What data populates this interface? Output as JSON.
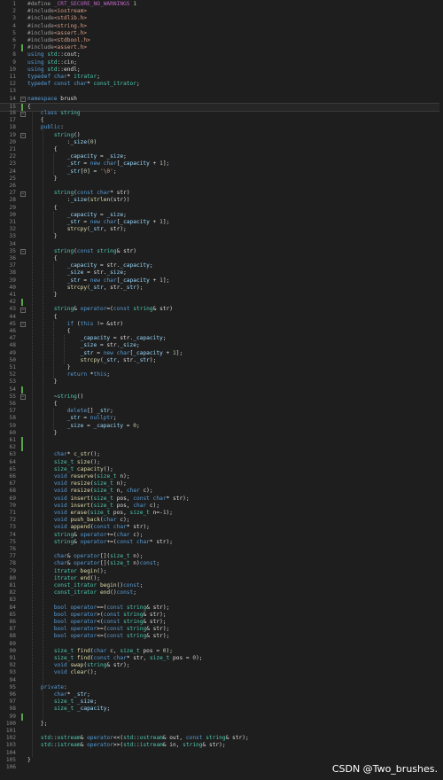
{
  "editor": {
    "current_line": 15,
    "lines": [
      {
        "n": "1",
        "t": "#define _CRT_SECURE_NO_WARNINGS 1",
        "c": "pp"
      },
      {
        "n": "2",
        "t": "#include<iostream>",
        "c": "pp"
      },
      {
        "n": "3",
        "t": "#include<stdlib.h>",
        "c": "pp"
      },
      {
        "n": "4",
        "t": "#include<string.h>",
        "c": "pp"
      },
      {
        "n": "5",
        "t": "#include<assert.h>",
        "c": "pp"
      },
      {
        "n": "6",
        "t": "#include<stdbool.h>",
        "c": "pp"
      },
      {
        "n": "7",
        "t": "#include<assert.h>",
        "c": "pp"
      },
      {
        "n": "8",
        "t": "using std::cout;",
        "c": ""
      },
      {
        "n": "9",
        "t": "using std::cin;",
        "c": ""
      },
      {
        "n": "10",
        "t": "using std::endl;",
        "c": ""
      },
      {
        "n": "11",
        "t": "typedef char* itrator;",
        "c": ""
      },
      {
        "n": "12",
        "t": "typedef const char* const_itrator;",
        "c": ""
      },
      {
        "n": "13",
        "t": "",
        "c": ""
      },
      {
        "n": "14",
        "t": "namespace brush",
        "c": ""
      },
      {
        "n": "15",
        "t": "{",
        "c": ""
      },
      {
        "n": "16",
        "t": "    class string",
        "c": ""
      },
      {
        "n": "17",
        "t": "    {",
        "c": ""
      },
      {
        "n": "18",
        "t": "    public:",
        "c": ""
      },
      {
        "n": "19",
        "t": "        string()",
        "c": ""
      },
      {
        "n": "20",
        "t": "            :_size(0)",
        "c": ""
      },
      {
        "n": "21",
        "t": "        {",
        "c": ""
      },
      {
        "n": "22",
        "t": "            _capacity = _size;",
        "c": ""
      },
      {
        "n": "23",
        "t": "            _str = new char[_capacity + 1];",
        "c": ""
      },
      {
        "n": "24",
        "t": "            _str[0] = '\\0';",
        "c": ""
      },
      {
        "n": "25",
        "t": "        }",
        "c": ""
      },
      {
        "n": "26",
        "t": "",
        "c": ""
      },
      {
        "n": "27",
        "t": "        string(const char* str)",
        "c": ""
      },
      {
        "n": "28",
        "t": "            :_size(strlen(str))",
        "c": ""
      },
      {
        "n": "29",
        "t": "        {",
        "c": ""
      },
      {
        "n": "30",
        "t": "            _capacity = _size;",
        "c": ""
      },
      {
        "n": "31",
        "t": "            _str = new char[_capacity + 1];",
        "c": ""
      },
      {
        "n": "32",
        "t": "            strcpy(_str, str);",
        "c": ""
      },
      {
        "n": "33",
        "t": "        }",
        "c": ""
      },
      {
        "n": "34",
        "t": "",
        "c": ""
      },
      {
        "n": "35",
        "t": "        string(const string& str)",
        "c": ""
      },
      {
        "n": "36",
        "t": "        {",
        "c": ""
      },
      {
        "n": "37",
        "t": "            _capacity = str._capacity;",
        "c": ""
      },
      {
        "n": "38",
        "t": "            _size = str._size;",
        "c": ""
      },
      {
        "n": "39",
        "t": "            _str = new char[_capacity + 1];",
        "c": ""
      },
      {
        "n": "40",
        "t": "            strcpy(_str, str._str);",
        "c": ""
      },
      {
        "n": "41",
        "t": "        }",
        "c": ""
      },
      {
        "n": "42",
        "t": "",
        "c": ""
      },
      {
        "n": "43",
        "t": "        string& operator=(const string& str)",
        "c": ""
      },
      {
        "n": "44",
        "t": "        {",
        "c": ""
      },
      {
        "n": "45",
        "t": "            if (this != &str)",
        "c": ""
      },
      {
        "n": "46",
        "t": "            {",
        "c": ""
      },
      {
        "n": "47",
        "t": "                _capacity = str._capacity;",
        "c": ""
      },
      {
        "n": "48",
        "t": "                _size = str._size;",
        "c": ""
      },
      {
        "n": "49",
        "t": "                _str = new char[_capacity + 1];",
        "c": ""
      },
      {
        "n": "50",
        "t": "                strcpy(_str, str._str);",
        "c": ""
      },
      {
        "n": "51",
        "t": "            }",
        "c": ""
      },
      {
        "n": "52",
        "t": "            return *this;",
        "c": ""
      },
      {
        "n": "53",
        "t": "        }",
        "c": ""
      },
      {
        "n": "54",
        "t": "",
        "c": ""
      },
      {
        "n": "55",
        "t": "        ~string()",
        "c": ""
      },
      {
        "n": "56",
        "t": "        {",
        "c": ""
      },
      {
        "n": "57",
        "t": "            delete[] _str;",
        "c": ""
      },
      {
        "n": "58",
        "t": "            _str = nullptr;",
        "c": ""
      },
      {
        "n": "59",
        "t": "            _size = _capacity = 0;",
        "c": ""
      },
      {
        "n": "60",
        "t": "        }",
        "c": ""
      },
      {
        "n": "61",
        "t": "",
        "c": ""
      },
      {
        "n": "62",
        "t": "",
        "c": ""
      },
      {
        "n": "63",
        "t": "        char* c_str();",
        "c": ""
      },
      {
        "n": "64",
        "t": "        size_t size();",
        "c": ""
      },
      {
        "n": "65",
        "t": "        size_t capacity();",
        "c": ""
      },
      {
        "n": "66",
        "t": "        void reserve(size_t n);",
        "c": ""
      },
      {
        "n": "67",
        "t": "        void resize(size_t n);",
        "c": ""
      },
      {
        "n": "68",
        "t": "        void resize(size_t n, char c);",
        "c": ""
      },
      {
        "n": "69",
        "t": "        void insert(size_t pos, const char* str);",
        "c": ""
      },
      {
        "n": "70",
        "t": "        void insert(size_t pos, char c);",
        "c": ""
      },
      {
        "n": "71",
        "t": "        void erase(size_t pos, size_t n=-1);",
        "c": ""
      },
      {
        "n": "72",
        "t": "        void push_back(char c);",
        "c": ""
      },
      {
        "n": "73",
        "t": "        void append(const char* str);",
        "c": ""
      },
      {
        "n": "74",
        "t": "        string& operator+=(char c);",
        "c": ""
      },
      {
        "n": "75",
        "t": "        string& operator+=(const char* str);",
        "c": ""
      },
      {
        "n": "76",
        "t": "",
        "c": ""
      },
      {
        "n": "77",
        "t": "        char& operator[](size_t n);",
        "c": ""
      },
      {
        "n": "78",
        "t": "        char& operator[](size_t n)const;",
        "c": ""
      },
      {
        "n": "79",
        "t": "        itrator begin();",
        "c": ""
      },
      {
        "n": "80",
        "t": "        itrator end();",
        "c": ""
      },
      {
        "n": "81",
        "t": "        const_itrator begin()const;",
        "c": ""
      },
      {
        "n": "82",
        "t": "        const_itrator end()const;",
        "c": ""
      },
      {
        "n": "83",
        "t": "",
        "c": ""
      },
      {
        "n": "84",
        "t": "        bool operator==(const string& str);",
        "c": ""
      },
      {
        "n": "85",
        "t": "        bool operator>(const string& str);",
        "c": ""
      },
      {
        "n": "86",
        "t": "        bool operator<(const string& str);",
        "c": ""
      },
      {
        "n": "87",
        "t": "        bool operator>=(const string& str);",
        "c": ""
      },
      {
        "n": "88",
        "t": "        bool operator<=(const string& str);",
        "c": ""
      },
      {
        "n": "89",
        "t": "",
        "c": ""
      },
      {
        "n": "90",
        "t": "        size_t find(char c, size_t pos = 0);",
        "c": ""
      },
      {
        "n": "91",
        "t": "        size_t find(const char* str, size_t pos = 0);",
        "c": ""
      },
      {
        "n": "92",
        "t": "        void swap(string& str);",
        "c": ""
      },
      {
        "n": "93",
        "t": "        void clear();",
        "c": ""
      },
      {
        "n": "94",
        "t": "",
        "c": ""
      },
      {
        "n": "95",
        "t": "    private:",
        "c": ""
      },
      {
        "n": "96",
        "t": "        char* _str;",
        "c": ""
      },
      {
        "n": "97",
        "t": "        size_t _size;",
        "c": ""
      },
      {
        "n": "98",
        "t": "        size_t _capacity;",
        "c": ""
      },
      {
        "n": "99",
        "t": "",
        "c": ""
      },
      {
        "n": "100",
        "t": "    };",
        "c": ""
      },
      {
        "n": "101",
        "t": "",
        "c": ""
      },
      {
        "n": "102",
        "t": "    std::ostream& operator<<(std::ostream& out, const string& str);",
        "c": ""
      },
      {
        "n": "103",
        "t": "    std::istream& operator>>(std::istream& in, string& str);",
        "c": ""
      },
      {
        "n": "104",
        "t": "",
        "c": ""
      },
      {
        "n": "105",
        "t": "}",
        "c": ""
      },
      {
        "n": "106",
        "t": "",
        "c": ""
      }
    ],
    "green_bar_lines": [
      7,
      15,
      42,
      54,
      61,
      62,
      99
    ],
    "fold_lines": [
      14,
      16,
      19,
      27,
      35,
      43,
      45,
      55
    ]
  },
  "watermark": "CSDN @Two_brushes.",
  "colors": {
    "background": "#1e1e1e",
    "keyword": "#569cd6",
    "type": "#4ec9b0",
    "function": "#dcdcaa",
    "string": "#d69d85",
    "preprocessor": "#9b9b9b",
    "line_number": "#858585",
    "change_bar": "#57a64a"
  }
}
